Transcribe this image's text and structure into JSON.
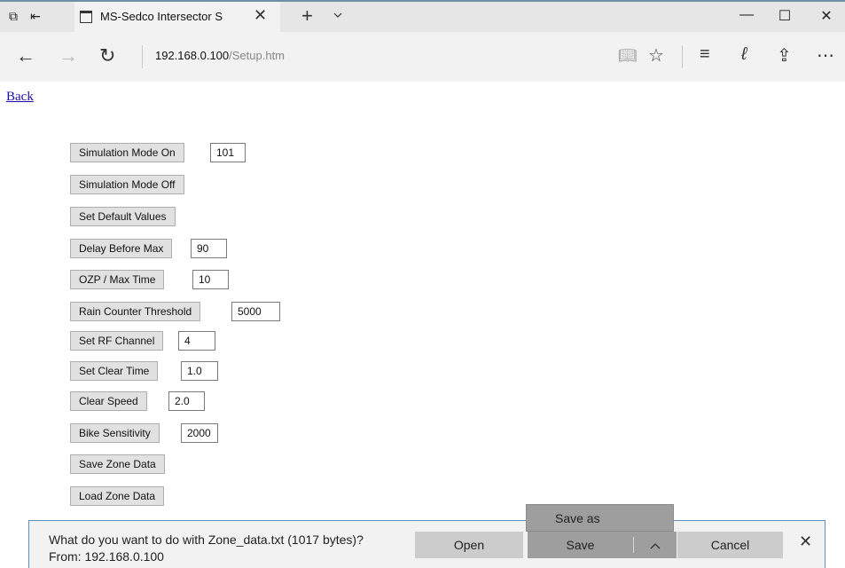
{
  "browser": {
    "tab_title": "MS-Sedco Intersector S",
    "url_host": "192.168.0.100",
    "url_path": "/Setup.htm"
  },
  "page": {
    "back_link": "Back",
    "controls": [
      {
        "button": "Simulation Mode On",
        "value": "101"
      },
      {
        "button": "Simulation Mode Off"
      },
      {
        "button": "Set Default Values"
      },
      {
        "button": "Delay Before Max",
        "value": "90"
      },
      {
        "button": "OZP / Max Time",
        "value": "10"
      },
      {
        "button": "Rain Counter Threshold",
        "value": "5000"
      },
      {
        "button": "Set RF Channel",
        "value": "4"
      },
      {
        "button": "Set Clear Time",
        "value": "1.0"
      },
      {
        "button": "Clear Speed",
        "value": "2.0"
      },
      {
        "button": "Bike Sensitivity",
        "value": "2000"
      },
      {
        "button": "Save Zone Data"
      },
      {
        "button": "Load Zone Data"
      }
    ]
  },
  "download": {
    "message": "What do you want to do with Zone_data.txt (1017 bytes)?",
    "from": "From: 192.168.0.100",
    "open_label": "Open",
    "save_label": "Save",
    "cancel_label": "Cancel",
    "save_as_label": "Save as"
  }
}
